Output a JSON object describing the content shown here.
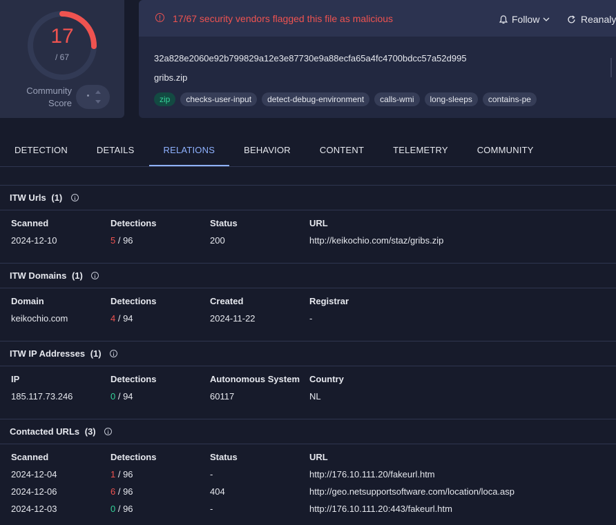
{
  "score": {
    "detected": "17",
    "total": "/ 67",
    "progress_fraction": 0.2537,
    "community_label_line1": "Community",
    "community_label_line2": "Score"
  },
  "alert": {
    "text": "17/67 security vendors flagged this file as malicious"
  },
  "actions": {
    "follow": "Follow",
    "reanalyze": "Reanalyz"
  },
  "file": {
    "hash": "32a828e2060e92b799829a12e3e87730e9a88ecfa65a4fc4700bdcc57a52d995",
    "name": "gribs.zip",
    "tags": [
      "zip",
      "checks-user-input",
      "detect-debug-environment",
      "calls-wmi",
      "long-sleeps",
      "contains-pe"
    ]
  },
  "tabs": [
    "DETECTION",
    "DETAILS",
    "RELATIONS",
    "BEHAVIOR",
    "CONTENT",
    "TELEMETRY",
    "COMMUNITY"
  ],
  "active_tab": "RELATIONS",
  "colors": {
    "malicious": "#ef5350",
    "clean": "#34d399",
    "accent": "#8fb2ff"
  },
  "itw_urls": {
    "title": "ITW Urls",
    "count": "(1)",
    "headers": [
      "Scanned",
      "Detections",
      "Status",
      "URL"
    ],
    "rows": [
      {
        "scanned": "2024-12-10",
        "det": "5",
        "det_total": " / 96",
        "status": "200",
        "url": "http://keikochio.com/staz/gribs.zip"
      }
    ]
  },
  "itw_domains": {
    "title": "ITW Domains",
    "count": "(1)",
    "headers": [
      "Domain",
      "Detections",
      "Created",
      "Registrar"
    ],
    "rows": [
      {
        "domain": "keikochio.com",
        "det": "4",
        "det_total": " / 94",
        "created": "2024-11-22",
        "registrar": "-"
      }
    ]
  },
  "itw_ips": {
    "title": "ITW IP Addresses",
    "count": "(1)",
    "headers": [
      "IP",
      "Detections",
      "Autonomous System",
      "Country"
    ],
    "rows": [
      {
        "ip": "185.117.73.246",
        "det": "0",
        "det_total": " / 94",
        "as": "60117",
        "country": "NL"
      }
    ]
  },
  "contacted_urls": {
    "title": "Contacted URLs",
    "count": "(3)",
    "headers": [
      "Scanned",
      "Detections",
      "Status",
      "URL"
    ],
    "rows": [
      {
        "scanned": "2024-12-04",
        "det": "1",
        "det_total": " / 96",
        "status": "-",
        "url": "http://176.10.111.20/fakeurl.htm"
      },
      {
        "scanned": "2024-12-06",
        "det": "6",
        "det_total": " / 96",
        "status": "404",
        "url": "http://geo.netsupportsoftware.com/location/loca.asp"
      },
      {
        "scanned": "2024-12-03",
        "det": "0",
        "det_total": " / 96",
        "status": "-",
        "url": "http://176.10.111.20:443/fakeurl.htm"
      }
    ]
  }
}
